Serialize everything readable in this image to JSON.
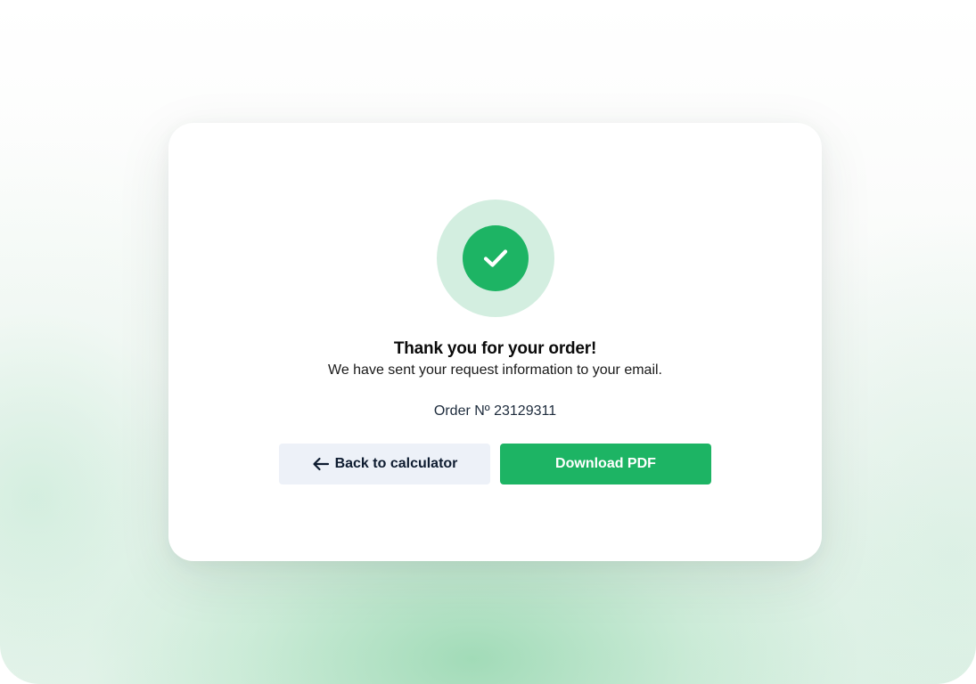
{
  "confirmation": {
    "icon": "checkmark-circle-icon",
    "title": "Thank you for your order!",
    "message": "We have sent your request information to your email.",
    "order_label": "Order Nº 23129311"
  },
  "actions": {
    "back_label": "Back to calculator",
    "back_icon": "arrow-left-icon",
    "download_label": "Download PDF"
  },
  "colors": {
    "accent": "#1db464",
    "accent_light": "#d3eee0",
    "secondary_button_bg": "#edf1f8",
    "text_dark": "#0e1c30"
  }
}
